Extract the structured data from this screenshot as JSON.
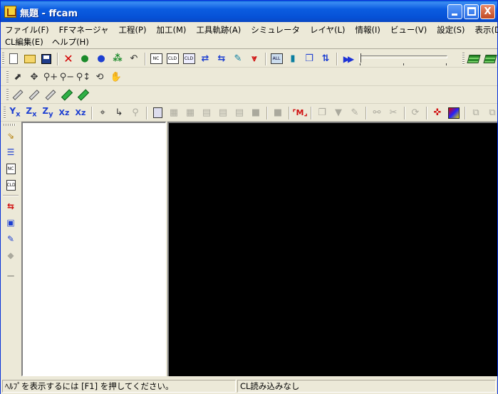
{
  "window": {
    "title": "無題 - ffcam",
    "controls": {
      "minimize": "minimize",
      "maximize": "maximize",
      "close": "X"
    }
  },
  "menu": {
    "row1": [
      "ファイル(F)",
      "FFマネージャ",
      "工程(P)",
      "加工(M)",
      "工具軌跡(A)",
      "シミュレータ",
      "レイヤ(L)",
      "情報(I)",
      "ビュー(V)",
      "設定(S)",
      "表示(D)"
    ],
    "row2": [
      "CL編集(E)",
      "ヘルプ(H)"
    ]
  },
  "toolbars": {
    "main": {
      "nc_label": "NC",
      "cld_label": "CLD",
      "all_label": "ALL"
    },
    "axes": {
      "x_label": "x",
      "z_label": "z",
      "y_label": "y"
    }
  },
  "sidebar": {
    "nc_label": "NC",
    "cld_label": "CLD"
  },
  "status": {
    "help": "ﾍﾙﾌﾟを表示するには [F1] を押してください。",
    "cl_status": "CL読み込みなし"
  }
}
